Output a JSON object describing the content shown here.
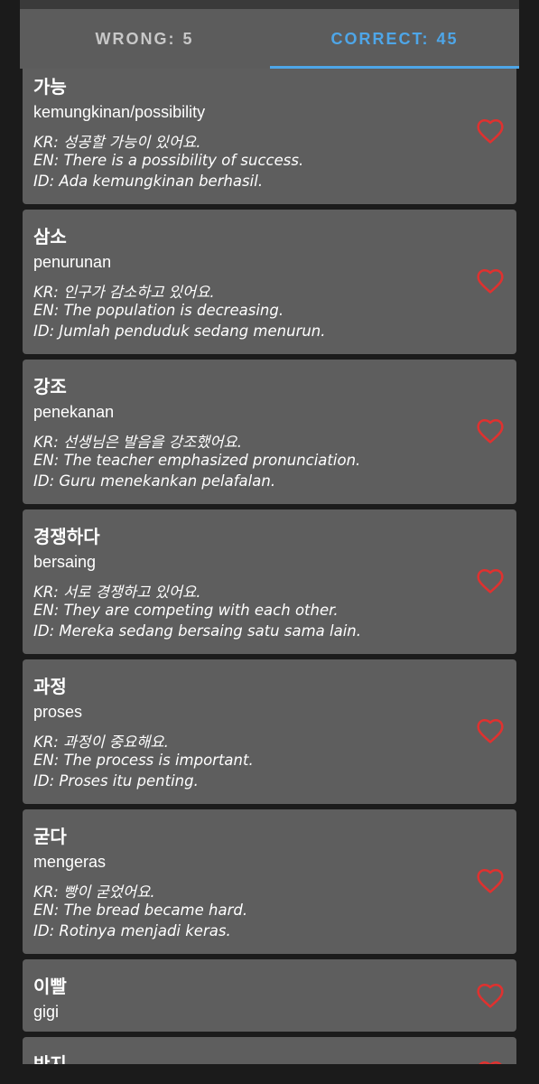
{
  "tabs": {
    "wrong": {
      "label": "WRONG:",
      "count": "5"
    },
    "correct": {
      "label": "CORRECT:",
      "count": "45"
    }
  },
  "colors": {
    "accent": "#4ea6e8",
    "heart": "#e0312f",
    "card": "#5e5e5e",
    "background": "#1b1b1b"
  },
  "cards": [
    {
      "word": "가능",
      "meaning": "kemungkinan/possibility",
      "kr": "KR: 성공할 가능이 있어요.",
      "en": "EN: There is a possibility of success.",
      "id": "ID: Ada kemungkinan berhasil.",
      "icon": "heart-outline-icon"
    },
    {
      "word": "삼소",
      "meaning": "penurunan",
      "kr": "KR: 인구가 감소하고 있어요.",
      "en": "EN: The population is decreasing.",
      "id": "ID: Jumlah penduduk sedang menurun.",
      "icon": "heart-outline-icon"
    },
    {
      "word": "강조",
      "meaning": "penekanan",
      "kr": "KR: 선생님은 발음을 강조했어요.",
      "en": "EN: The teacher emphasized pronunciation.",
      "id": "ID: Guru menekankan pelafalan.",
      "icon": "heart-outline-icon"
    },
    {
      "word": "경쟁하다",
      "meaning": "bersaing",
      "kr": "KR: 서로 경쟁하고 있어요.",
      "en": "EN: They are competing with each other.",
      "id": "ID: Mereka sedang bersaing satu sama lain.",
      "icon": "heart-outline-icon"
    },
    {
      "word": "과정",
      "meaning": "proses",
      "kr": "KR: 과정이 중요해요.",
      "en": "EN: The process is important.",
      "id": "ID: Proses itu penting.",
      "icon": "heart-outline-icon"
    },
    {
      "word": "굳다",
      "meaning": "mengeras",
      "kr": "KR: 빵이 굳었어요.",
      "en": "EN: The bread became hard.",
      "id": "ID: Rotinya menjadi keras.",
      "icon": "heart-outline-icon"
    },
    {
      "word": "이빨",
      "meaning": "gigi",
      "icon": "heart-outline-icon"
    },
    {
      "word": "반지",
      "icon": "heart-outline-icon"
    }
  ]
}
